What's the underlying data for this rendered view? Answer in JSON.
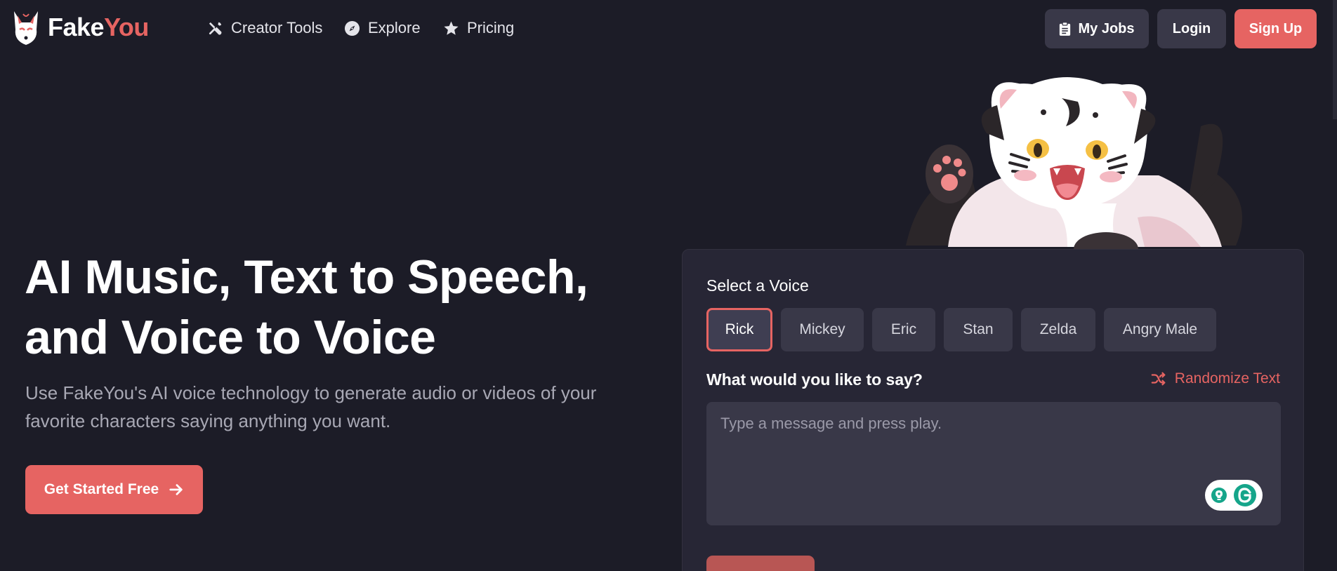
{
  "brand": {
    "name_part1": "Fake",
    "name_part2": "You"
  },
  "nav": {
    "links": [
      {
        "label": "Creator Tools",
        "icon": "tools-icon"
      },
      {
        "label": "Explore",
        "icon": "compass-icon"
      },
      {
        "label": "Pricing",
        "icon": "star-icon"
      }
    ],
    "my_jobs": "My Jobs",
    "login": "Login",
    "signup": "Sign Up"
  },
  "hero": {
    "title_line1": "AI Music, Text to Speech,",
    "title_line2": "and Voice to Voice",
    "subtitle": "Use FakeYou's AI voice technology to generate audio or videos of your favorite characters saying anything you want.",
    "cta": "Get Started Free"
  },
  "tts_card": {
    "select_label": "Select a Voice",
    "voices": [
      "Rick",
      "Mickey",
      "Eric",
      "Stan",
      "Zelda",
      "Angry Male"
    ],
    "selected_voice": "Rick",
    "prompt_label": "What would you like to say?",
    "randomize_label": "Randomize Text",
    "textarea_placeholder": "Type a message and press play."
  },
  "colors": {
    "background": "#1c1c27",
    "accent": "#e66462",
    "card": "#272635",
    "button_dark": "#393848"
  }
}
